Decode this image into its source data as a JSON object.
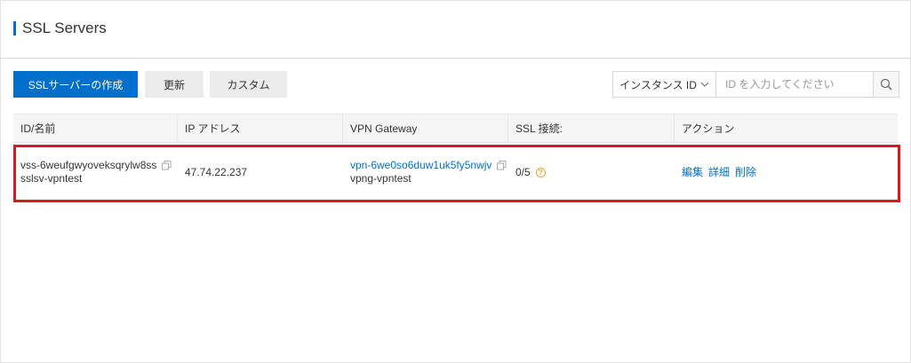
{
  "header": {
    "title": "SSL Servers"
  },
  "toolbar": {
    "create_label": "SSLサーバーの作成",
    "refresh_label": "更新",
    "custom_label": "カスタム"
  },
  "search": {
    "select_label": "インスタンス ID",
    "placeholder": "ID を入力してください"
  },
  "table": {
    "columns": [
      "ID/名前",
      "IP アドレス",
      "VPN Gateway",
      "SSL 接続:",
      "アクション"
    ],
    "rows": [
      {
        "id": "vss-6weufgwyoveksqrylw8ss",
        "name": "sslsv-vpntest",
        "ip": "47.74.22.237",
        "gateway_id": "vpn-6we0so6duw1uk5fy5nwjv",
        "gateway_name": "vpng-vpntest",
        "ssl_connections": "0/5",
        "actions": {
          "edit": "編集",
          "detail": "詳細",
          "delete": "削除"
        }
      }
    ]
  },
  "icons": {
    "search": "search-icon",
    "dropdown": "chevron-down-icon",
    "copy": "copy-icon",
    "help": "help-icon"
  },
  "colors": {
    "primary": "#0070cc",
    "highlight_border": "#e0161e",
    "help": "#f5a623"
  }
}
